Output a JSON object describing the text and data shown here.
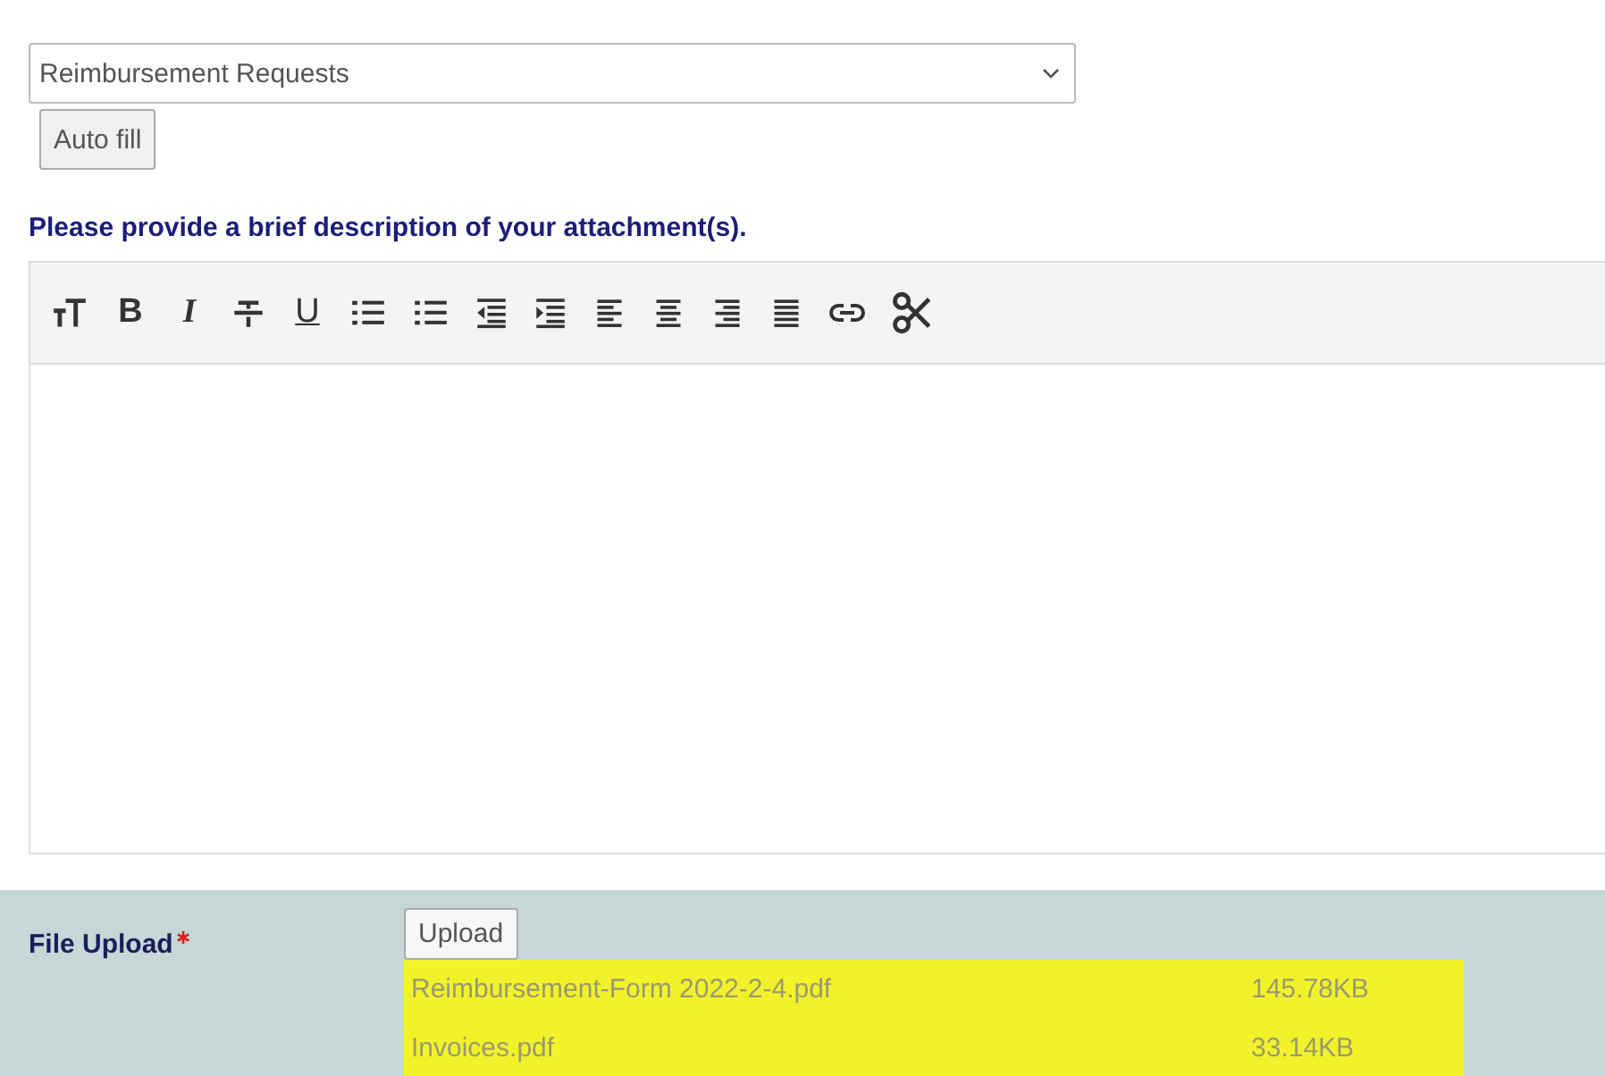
{
  "document_type": {
    "value": "Reimbursement Requests"
  },
  "auto_fill_button": "Auto fill",
  "description_label": "Please provide a brief description of your attachment(s).",
  "toolbar": [
    {
      "kind": "text-size"
    },
    {
      "kind": "bold",
      "label": "B"
    },
    {
      "kind": "italic",
      "label": "I"
    },
    {
      "kind": "strike"
    },
    {
      "kind": "underline",
      "label": "U"
    },
    {
      "kind": "bullets"
    },
    {
      "kind": "numbers"
    },
    {
      "kind": "outdent"
    },
    {
      "kind": "indent"
    },
    {
      "kind": "align-left"
    },
    {
      "kind": "align-center"
    },
    {
      "kind": "align-right"
    },
    {
      "kind": "justify"
    },
    {
      "kind": "link"
    },
    {
      "kind": "scissors"
    }
  ],
  "file_upload": {
    "label": "File Upload",
    "required": true,
    "button": "Upload",
    "files": [
      {
        "name": "Reimbursement-Form 2022-2-4.pdf",
        "size": "145.78KB",
        "highlighted": true
      },
      {
        "name": "Invoices.pdf",
        "size": "33.14KB",
        "highlighted": true
      }
    ]
  }
}
